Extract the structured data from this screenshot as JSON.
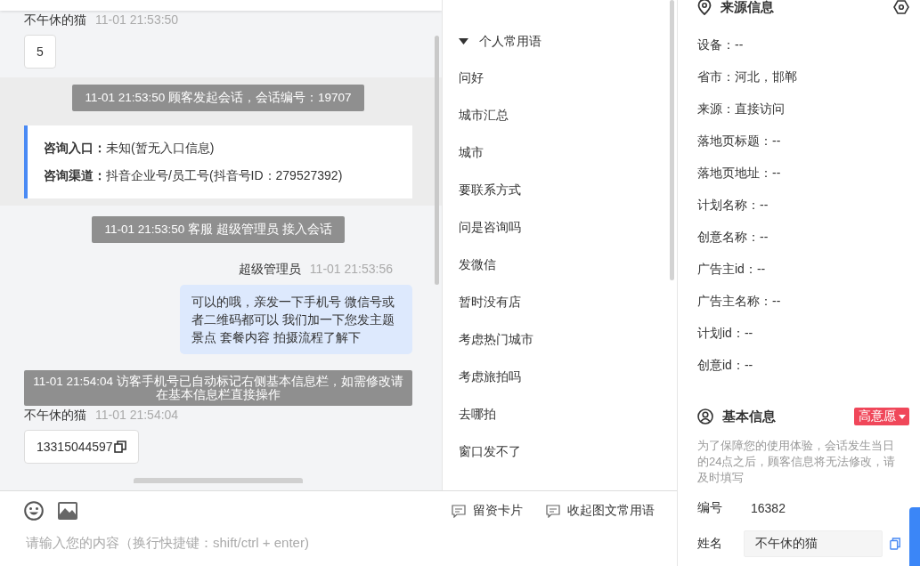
{
  "chat": {
    "messages": [
      {
        "kind": "customer",
        "sender": "不午休的猫",
        "time": "11-01 21:53:50",
        "text": "5",
        "copyable": false
      },
      {
        "kind": "group",
        "children": [
          {
            "kind": "system",
            "text": "11-01 21:53:50 顾客发起会话，会话编号：19707"
          },
          {
            "kind": "card",
            "lines": [
              "**咨询入口：**未知(暂无入口信息)",
              "**咨询渠道：**抖音企业号/员工号(抖音号ID：279527392)"
            ]
          }
        ]
      },
      {
        "kind": "system",
        "text": "11-01 21:53:50 客服 超级管理员 接入会话"
      },
      {
        "kind": "agent",
        "sender": "超级管理员",
        "time": "11-01 21:53:56",
        "text": "可以的哦，亲发一下手机号 微信号或者二维码都可以 我们加一下您发主题景点 套餐内容 拍摄流程了解下"
      },
      {
        "kind": "notice",
        "text": "11-01 21:54:04 访客手机号已自动标记右侧基本信息栏，如需修改请在基本信息栏直接操作"
      },
      {
        "kind": "customer",
        "sender": "不午休的猫",
        "time": "11-01 21:54:04",
        "text": "13315044597",
        "copyable": true
      }
    ]
  },
  "phrases": {
    "group": {
      "label": "个人常用语",
      "expanded": true
    },
    "items": [
      "问好",
      "城市汇总",
      "城市",
      "要联系方式",
      "问是咨询吗",
      "发微信",
      "暂时没有店",
      "考虑热门城市",
      "考虑旅拍吗",
      "去哪拍",
      "窗口发不了"
    ]
  },
  "composer": {
    "actions": [
      "留资卡片",
      "收起图文常用语"
    ],
    "placeholder": "请输入您的内容（换行快捷键：shift/ctrl + enter)"
  },
  "source": {
    "title": "来源信息",
    "rows": [
      "设备：--",
      "省市：河北，邯郸",
      "来源：直接访问",
      "落地页标题：--",
      "落地页地址：--",
      "计划名称：--",
      "创意名称：--",
      "广告主id：--",
      "广告主名称：--",
      "计划id：--",
      "创意id：--"
    ]
  },
  "basic": {
    "title": "基本信息",
    "intent": "高意愿",
    "notice": "为了保障您的使用体验，会话发生当日的24点之后，顾客信息将无法修改，请及时填写",
    "fields": [
      {
        "kind": "text",
        "label": "编号",
        "value": "16382"
      },
      {
        "kind": "input",
        "label": "姓名",
        "value": "不午休的猫"
      }
    ]
  }
}
